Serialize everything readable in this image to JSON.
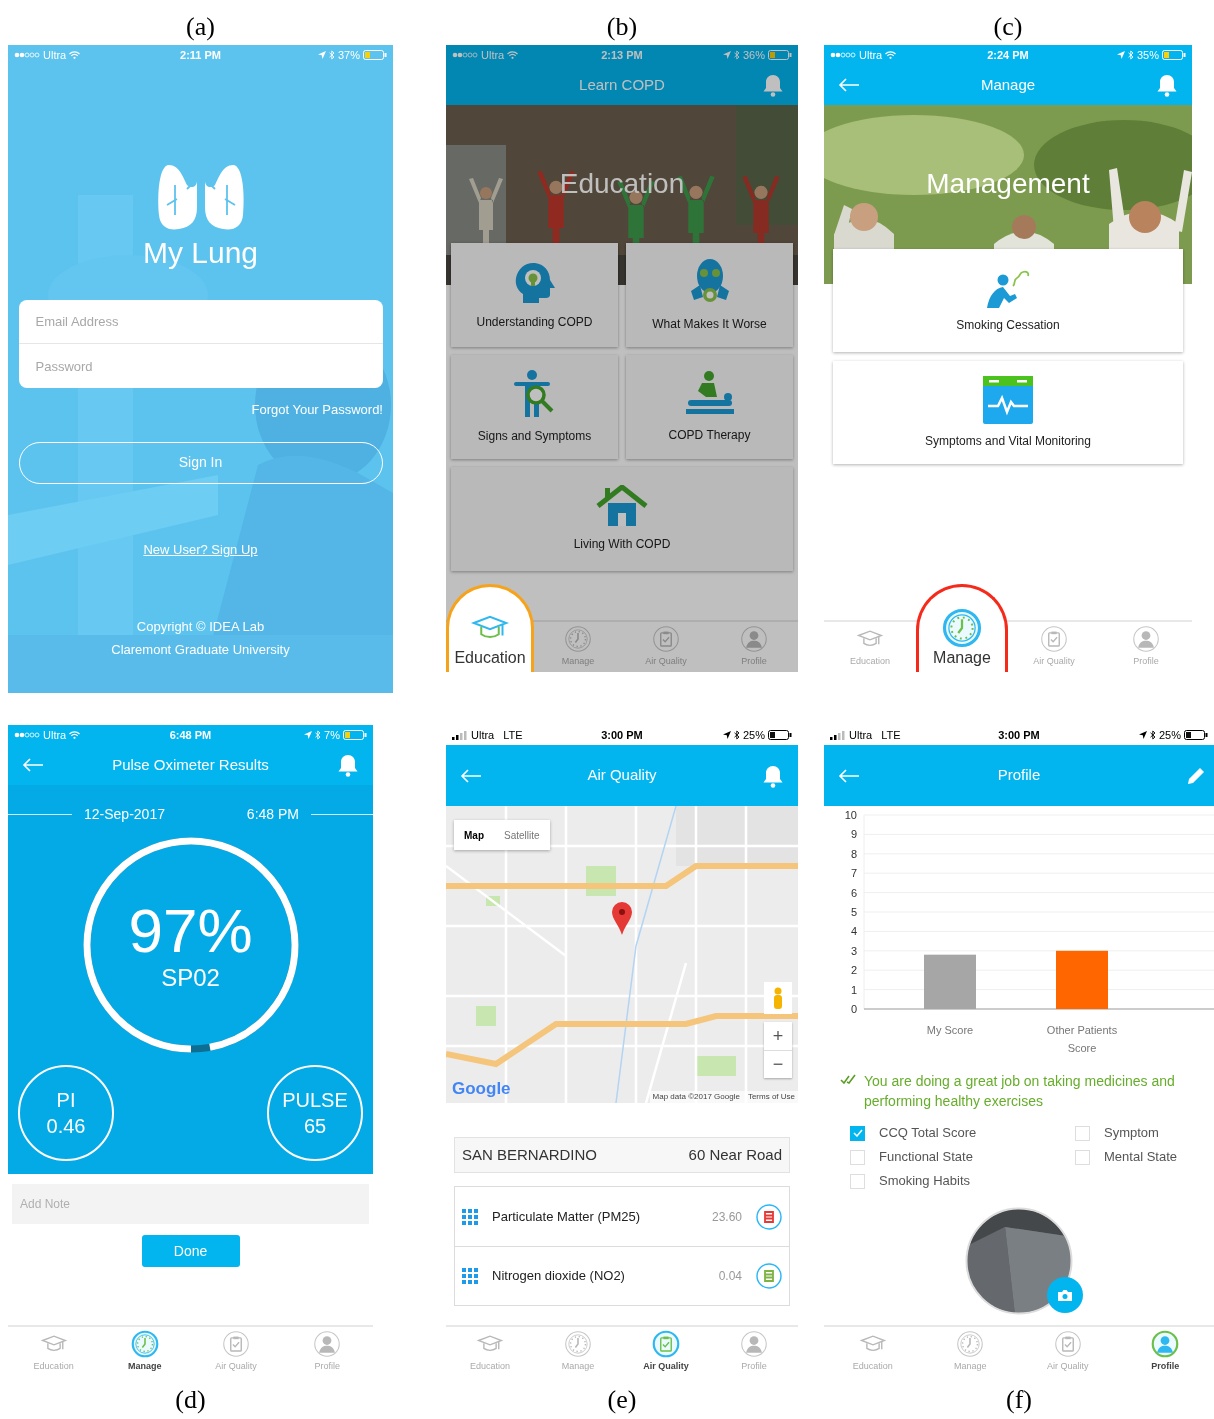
{
  "panels": [
    {
      "kind": "login",
      "caption": "(a)",
      "status_bar": {
        "carrier": "Ultra",
        "time": "2:11 PM",
        "battery": "37%"
      },
      "app_name": "My Lung",
      "fields": [
        {
          "placeholder": "Email Address"
        },
        {
          "placeholder": "Password"
        }
      ],
      "forgot_link": "Forgot Your Password!",
      "sign_in_button": "Sign In",
      "sign_up_link": "New User? Sign Up",
      "footer": [
        "Copyright © IDEA Lab",
        "Claremont Graduate University"
      ]
    },
    {
      "kind": "education",
      "caption": "(b)",
      "dimmed": true,
      "status_bar": {
        "carrier": "Ultra",
        "time": "2:13 PM",
        "battery": "36%"
      },
      "header": {
        "title": "Learn COPD",
        "back": false
      },
      "banner": "Education",
      "tiles": [
        "Understanding COPD",
        "What Makes It Worse",
        "Signs and Symptoms",
        "COPD Therapy",
        "Living With COPD"
      ],
      "tabs": [
        {
          "label": "Education",
          "selected": true,
          "color": "#f7a21b"
        },
        {
          "label": "Manage",
          "selected": false
        },
        {
          "label": "Air Quality",
          "selected": false
        },
        {
          "label": "Profile",
          "selected": false
        }
      ]
    },
    {
      "kind": "manage",
      "caption": "(c)",
      "status_bar": {
        "carrier": "Ultra",
        "time": "2:24 PM",
        "battery": "35%"
      },
      "header": {
        "title": "Manage",
        "back": true
      },
      "banner": "Management",
      "cards": [
        "Smoking Cessation",
        "Symptoms and Vital Monitoring"
      ],
      "tabs": [
        {
          "label": "Education",
          "selected": false
        },
        {
          "label": "Manage",
          "selected": true,
          "color": "#f52a1a"
        },
        {
          "label": "Air Quality",
          "selected": false
        },
        {
          "label": "Profile",
          "selected": false
        }
      ]
    },
    {
      "kind": "pulse",
      "caption": "(d)",
      "status_bar": {
        "carrier": "Ultra",
        "time": "6:48 PM",
        "battery": "7%"
      },
      "header": {
        "title": "Pulse Oximeter Results",
        "back": true
      },
      "reading_date": "12-Sep-2017",
      "reading_time": "6:48 PM",
      "gauge": {
        "value": "97%",
        "label": "SP02",
        "level": 0.97
      },
      "metrics": [
        {
          "label": "PI",
          "value": "0.46"
        },
        {
          "label": "PULSE",
          "value": "65"
        }
      ],
      "note": {
        "placeholder": "Add Note"
      },
      "done_button": "Done",
      "tabs": [
        {
          "label": "Education",
          "selected": false
        },
        {
          "label": "Manage",
          "selected": true
        },
        {
          "label": "Air Quality",
          "selected": false
        },
        {
          "label": "Profile",
          "selected": false
        }
      ]
    },
    {
      "kind": "air_quality",
      "caption": "(e)",
      "status_bar": {
        "carrier": "Ultra",
        "network": "LTE",
        "time": "3:00 PM",
        "battery": "25%"
      },
      "header": {
        "title": "Air Quality",
        "back": true
      },
      "map": {
        "toggle": [
          {
            "label": "Map",
            "selected": true
          },
          {
            "label": "Satellite",
            "selected": false
          }
        ],
        "zoom_in": "+",
        "zoom_out": "−",
        "logo": "Google",
        "attribution": "Map data ©2017 Google",
        "terms": "Terms of Use"
      },
      "station": {
        "name": "SAN BERNARDINO",
        "site": "60 Near Road"
      },
      "pollutants": [
        {
          "name": "Particulate Matter (PM25)",
          "value": "23.60",
          "color": "#e53935"
        },
        {
          "name": "Nitrogen dioxide (NO2)",
          "value": "0.04",
          "color": "#7cb342"
        }
      ],
      "tabs": [
        {
          "label": "Education",
          "selected": false
        },
        {
          "label": "Manage",
          "selected": false
        },
        {
          "label": "Air Quality",
          "selected": true
        },
        {
          "label": "Profile",
          "selected": false
        }
      ]
    },
    {
      "kind": "profile",
      "caption": "(f)",
      "status_bar": {
        "carrier": "Ultra",
        "network": "LTE",
        "time": "3:00 PM",
        "battery": "25%"
      },
      "header": {
        "title": "Profile",
        "back": true
      },
      "chart_data": {
        "type": "bar",
        "grid": true,
        "series": [
          {
            "name": "My Score",
            "color": "#a6a6a6",
            "values": [
              2.8,
              null
            ]
          },
          {
            "name": "Other Patients Score",
            "color": "#ff6600",
            "values": [
              null,
              3.0
            ]
          }
        ],
        "stacked": true,
        "ylim": [
          0,
          10
        ],
        "yticks": [
          0,
          1,
          2,
          3,
          4,
          5,
          6,
          7,
          8,
          9,
          10
        ]
      },
      "message": "You are doing a great job on taking medicines and performing healthy exercises",
      "checkboxes": [
        {
          "label": "CCQ Total Score",
          "checked": true
        },
        {
          "label": "Symptom",
          "checked": false
        },
        {
          "label": "Functional State",
          "checked": false
        },
        {
          "label": "Mental State",
          "checked": false
        },
        {
          "label": "Smoking Habits",
          "checked": false
        }
      ],
      "tabs": [
        {
          "label": "Education",
          "selected": false
        },
        {
          "label": "Manage",
          "selected": false
        },
        {
          "label": "Air Quality",
          "selected": false
        },
        {
          "label": "Profile",
          "selected": true
        }
      ]
    }
  ]
}
